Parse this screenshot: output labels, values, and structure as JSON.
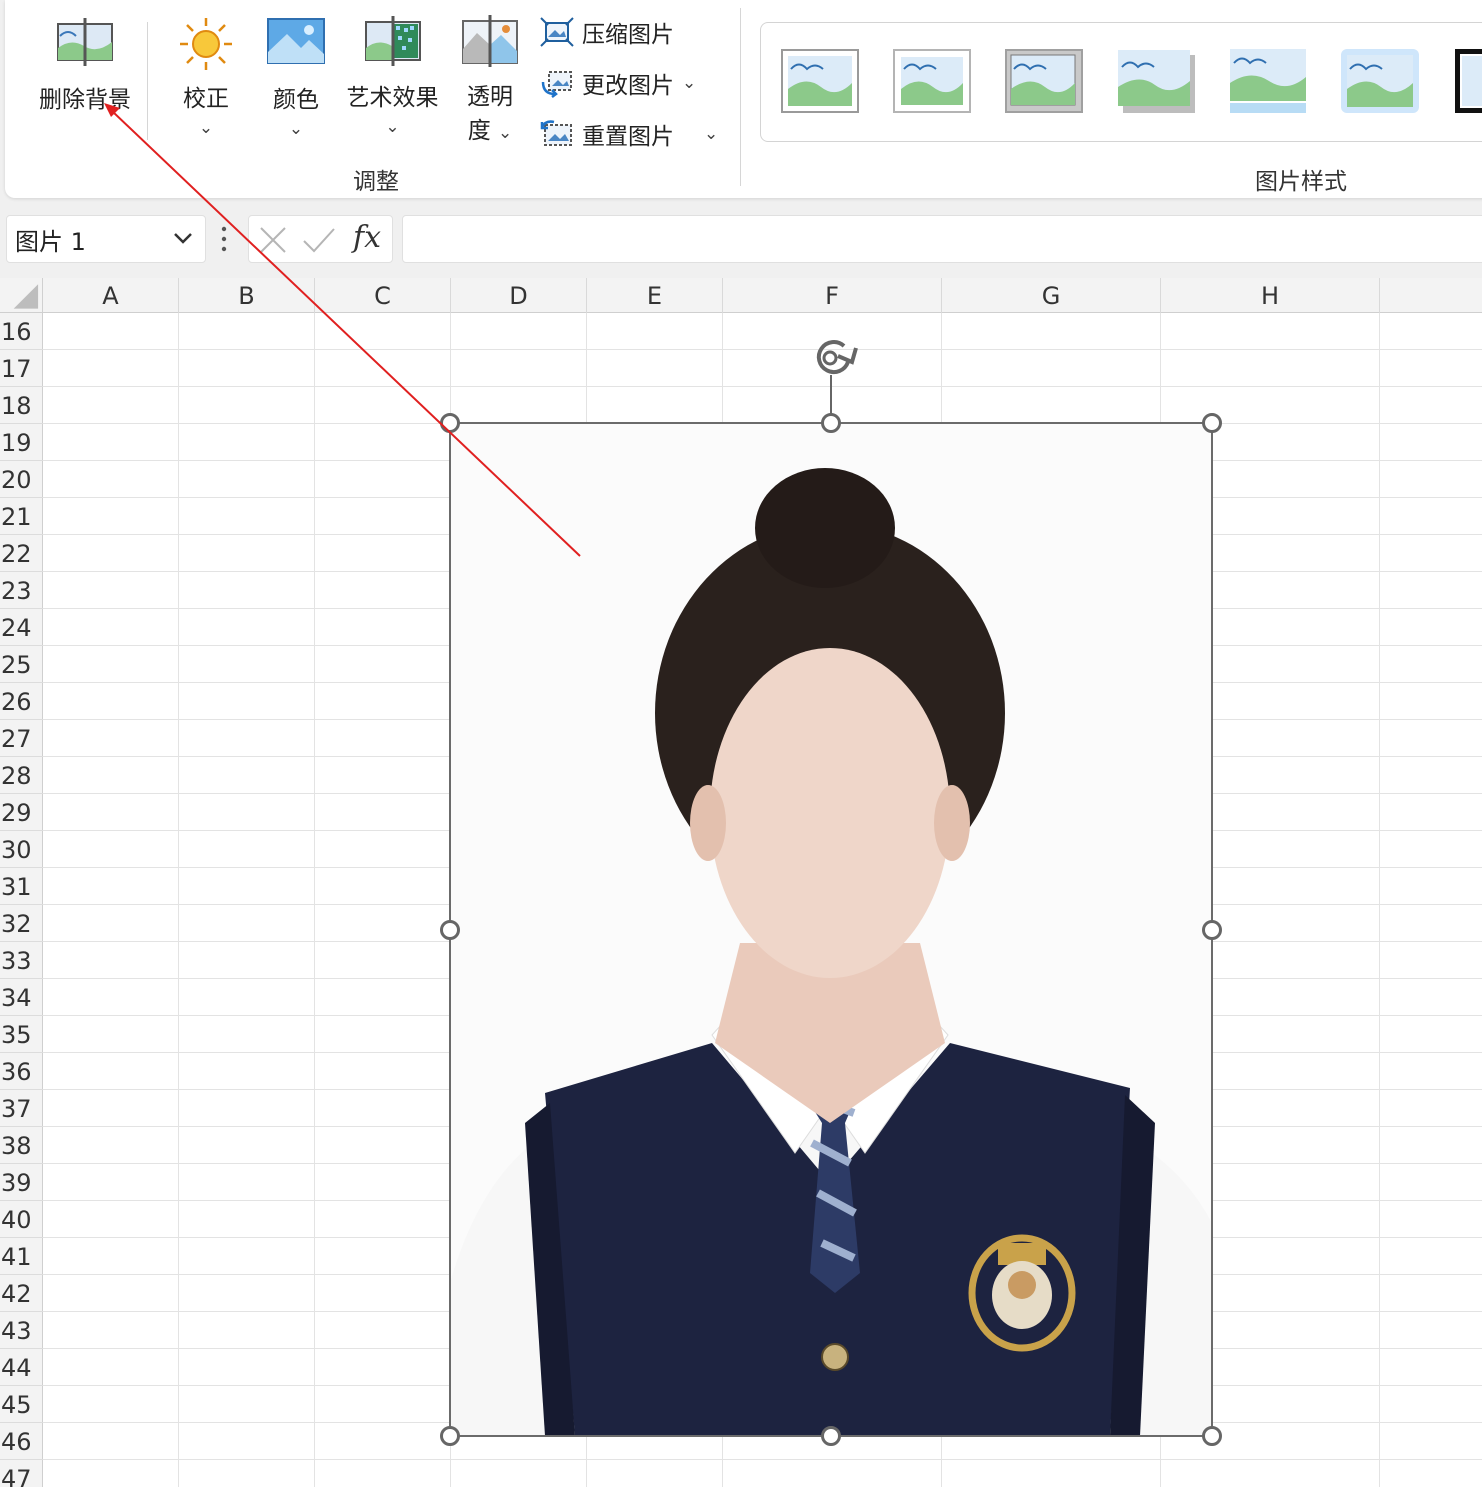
{
  "ribbon": {
    "adjust": {
      "group_label": "调整",
      "remove_background": "删除背景",
      "corrections": "校正",
      "color": "颜色",
      "artistic_effects": "艺术效果",
      "transparency_line1": "透明",
      "transparency_line2": "度",
      "compress_pictures": "压缩图片",
      "change_picture": "更改图片",
      "reset_picture": "重置图片"
    },
    "picture_styles": {
      "group_label": "图片样式",
      "count_visible": 7
    }
  },
  "formula_bar": {
    "name_box": "图片 1",
    "fx_label": "fx",
    "formula": ""
  },
  "sheet": {
    "columns": [
      "A",
      "B",
      "C",
      "D",
      "E",
      "F",
      "G",
      "H"
    ],
    "rows": [
      "16",
      "17",
      "18",
      "19",
      "20",
      "21",
      "22",
      "23",
      "24",
      "25",
      "26",
      "27",
      "28",
      "29",
      "30",
      "31",
      "32",
      "33",
      "34",
      "35",
      "36",
      "37",
      "38",
      "39",
      "40",
      "41",
      "42",
      "43",
      "44",
      "45",
      "46",
      "47"
    ]
  },
  "picture": {
    "name": "图片 1",
    "selected": true
  },
  "colors": {
    "annotation_arrow": "#e02020",
    "selection_frame": "#6b6b6b",
    "vest": "#1d2340",
    "shirt": "#ffffff",
    "skin": "#efd6c9",
    "hair": "#2a211d"
  }
}
